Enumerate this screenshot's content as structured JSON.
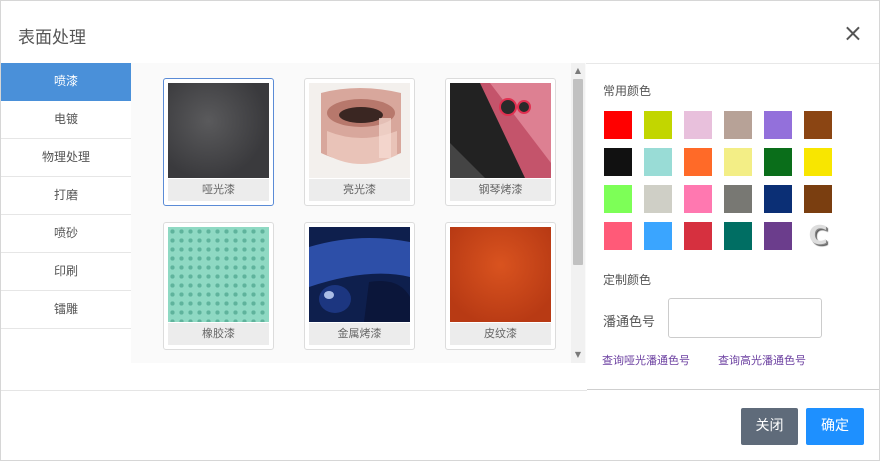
{
  "dialog": {
    "title": "表面处理",
    "close_glyph": "×"
  },
  "sidebar": {
    "items": [
      {
        "label": "喷漆",
        "active": true
      },
      {
        "label": "电镀"
      },
      {
        "label": "物理处理"
      },
      {
        "label": "打磨"
      },
      {
        "label": "喷砂"
      },
      {
        "label": "印刷"
      },
      {
        "label": "镭雕"
      }
    ]
  },
  "gallery": {
    "tiles": [
      {
        "label": "哑光漆",
        "selected": true,
        "texture": "dark-gray-matte"
      },
      {
        "label": "亮光漆",
        "texture": "rose-gold-metal"
      },
      {
        "label": "钢琴烤漆",
        "texture": "red-glossy-phone"
      },
      {
        "label": "橡胶漆",
        "texture": "mint-rubber-dots"
      },
      {
        "label": "金属烤漆",
        "texture": "blue-metallic-car"
      },
      {
        "label": "皮纹漆",
        "texture": "orange-leather"
      }
    ],
    "scroll": {
      "up": "▲",
      "down": "▼"
    }
  },
  "colors": {
    "common_label": "常用颜色",
    "swatches": [
      "#ff0000",
      "#c2d600",
      "#e8c0dc",
      "#b7a297",
      "#9370db",
      "#8b4513",
      "#111111",
      "#99dcd6",
      "#ff6a28",
      "#f3ee86",
      "#0a6e1a",
      "#f8e600",
      "#7dff57",
      "#cfcfc6",
      "#ff78b0",
      "#787873",
      "#0b2f75",
      "#7a3e10",
      "#ff5a78",
      "#3aa5ff",
      "#d6303f",
      "#006e63",
      "#6b3d8c"
    ],
    "custom_glyph": "C"
  },
  "custom": {
    "label": "定制颜色",
    "pantone_label": "潘通色号",
    "pantone_value": ""
  },
  "links": {
    "matte": "查询哑光潘通色号",
    "gloss": "查询高光潘通色号"
  },
  "footer": {
    "close_label": "关闭",
    "ok_label": "确定"
  }
}
